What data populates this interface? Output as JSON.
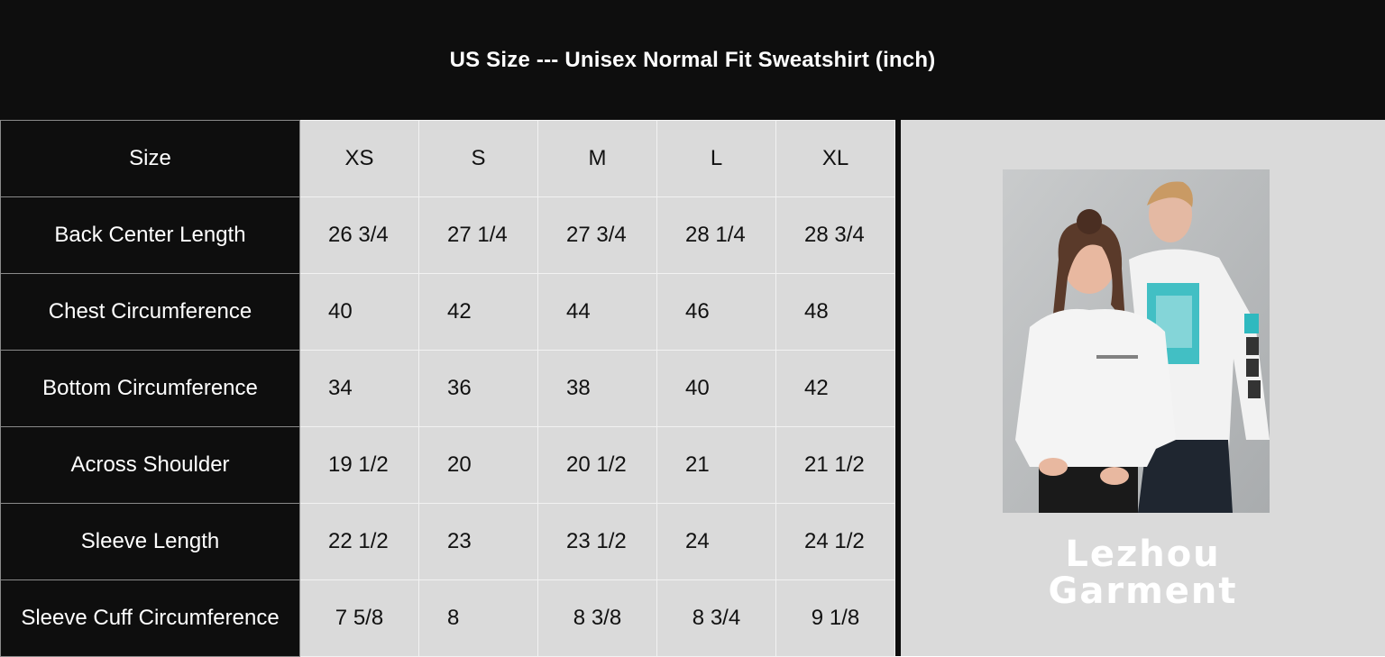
{
  "title": "US Size --- Unisex Normal Fit Sweatshirt (inch)",
  "header_row": {
    "label": "Size",
    "sizes": [
      "XS",
      "S",
      "M",
      "L",
      "XL"
    ]
  },
  "rows": [
    {
      "label": "Back Center Length",
      "values": [
        "26 3/4",
        "27 1/4",
        "27 3/4",
        "28 1/4",
        "28 3/4"
      ]
    },
    {
      "label": "Chest Circumference",
      "values": [
        "40",
        "42",
        "44",
        "46",
        "48"
      ]
    },
    {
      "label": "Bottom Circumference",
      "values": [
        "34",
        "36",
        "38",
        "40",
        "42"
      ]
    },
    {
      "label": "Across Shoulder",
      "values": [
        "19 1/2",
        "20",
        "20 1/2",
        "21",
        "21 1/2"
      ]
    },
    {
      "label": "Sleeve Length",
      "values": [
        "22 1/2",
        "23",
        "23 1/2",
        "24",
        "24 1/2"
      ]
    },
    {
      "label": "Sleeve Cuff Circumference",
      "values": [
        "7 5/8",
        "8",
        "8 3/8",
        "8 3/4",
        "9 1/8"
      ]
    }
  ],
  "brand_logo": {
    "line1": "Lezhou",
    "line2": "Garment"
  },
  "photo": {
    "description_icon": "models-photo"
  }
}
